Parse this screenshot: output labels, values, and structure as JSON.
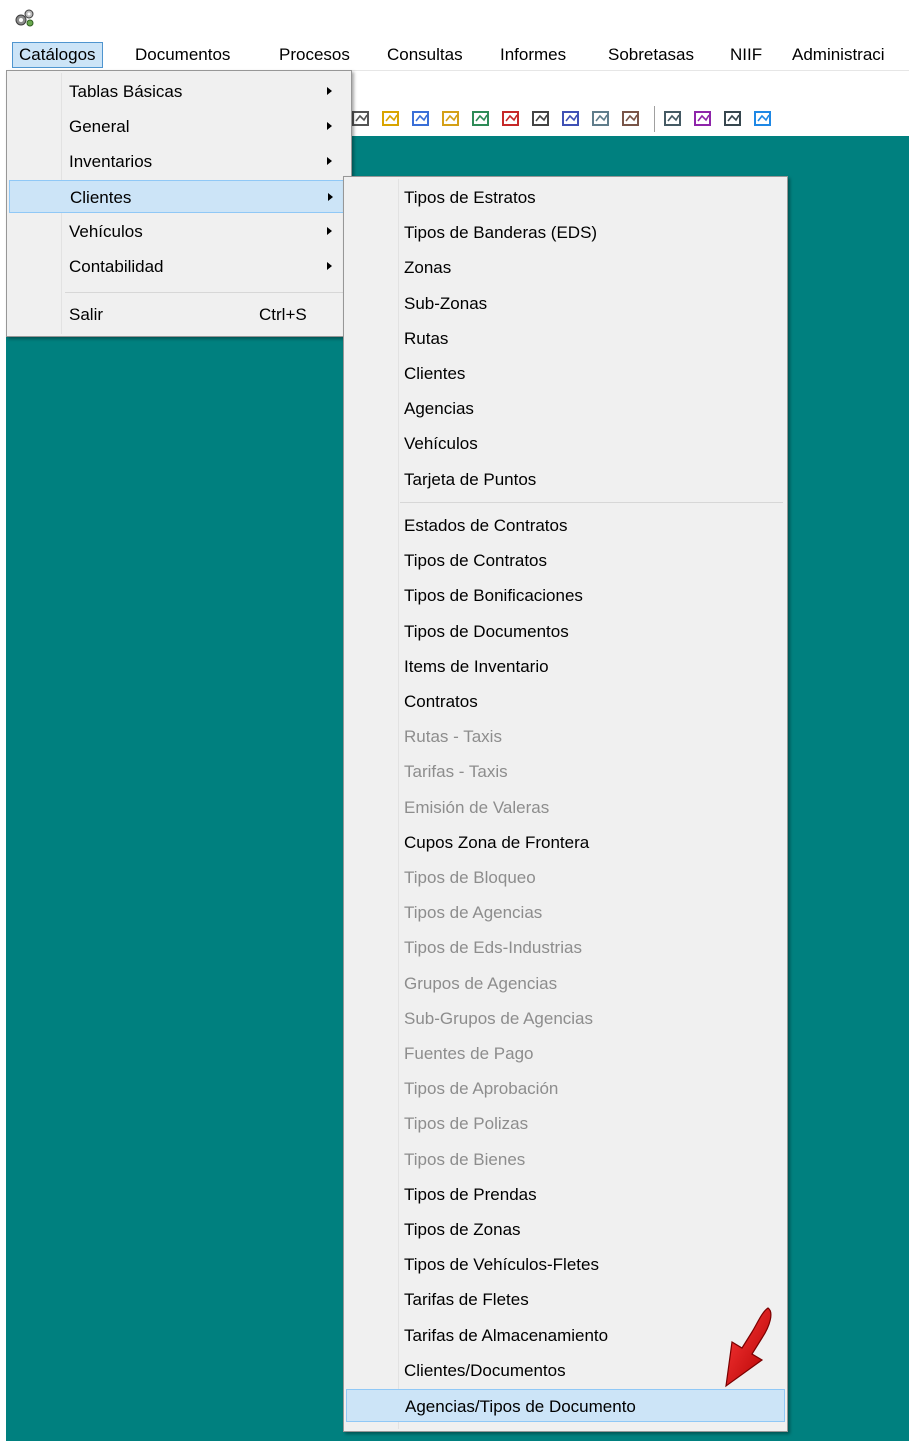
{
  "menubar": {
    "items": [
      "Catálogos",
      "Documentos",
      "Procesos",
      "Consultas",
      "Informes",
      "Sobretasas",
      "NIIF",
      "Administraci"
    ]
  },
  "catalogos_menu": {
    "items": [
      {
        "label": "Tablas Básicas",
        "submenu": true
      },
      {
        "label": "General",
        "submenu": true
      },
      {
        "label": "Inventarios",
        "submenu": true
      },
      {
        "label": "Clientes",
        "submenu": true,
        "highlighted": true
      },
      {
        "label": "Vehículos",
        "submenu": true
      },
      {
        "label": "Contabilidad",
        "submenu": true
      }
    ],
    "exit": {
      "label": "Salir",
      "shortcut": "Ctrl+S"
    }
  },
  "clientes_menu": {
    "group1": [
      {
        "label": "Tipos de Estratos",
        "enabled": true
      },
      {
        "label": "Tipos de Banderas (EDS)",
        "enabled": true
      },
      {
        "label": "Zonas",
        "enabled": true
      },
      {
        "label": "Sub-Zonas",
        "enabled": true
      },
      {
        "label": "Rutas",
        "enabled": true
      },
      {
        "label": "Clientes",
        "enabled": true
      },
      {
        "label": "Agencias",
        "enabled": true
      },
      {
        "label": "Vehículos",
        "enabled": true
      },
      {
        "label": "Tarjeta de Puntos",
        "enabled": true
      }
    ],
    "group2": [
      {
        "label": "Estados de Contratos",
        "enabled": true
      },
      {
        "label": "Tipos de Contratos",
        "enabled": true
      },
      {
        "label": "Tipos de Bonificaciones",
        "enabled": true
      },
      {
        "label": "Tipos de Documentos",
        "enabled": true
      },
      {
        "label": "Items de Inventario",
        "enabled": true
      },
      {
        "label": "Contratos",
        "enabled": true
      },
      {
        "label": "Rutas - Taxis",
        "enabled": false
      },
      {
        "label": "Tarifas - Taxis",
        "enabled": false
      },
      {
        "label": "Emisión de Valeras",
        "enabled": false
      },
      {
        "label": "Cupos Zona de Frontera",
        "enabled": true
      },
      {
        "label": "Tipos de Bloqueo",
        "enabled": false
      },
      {
        "label": "Tipos de Agencias",
        "enabled": false
      },
      {
        "label": "Tipos de Eds-Industrias",
        "enabled": false
      },
      {
        "label": "Grupos de Agencias",
        "enabled": false
      },
      {
        "label": "Sub-Grupos de Agencias",
        "enabled": false
      },
      {
        "label": "Fuentes de Pago",
        "enabled": false
      },
      {
        "label": "Tipos de Aprobación",
        "enabled": false
      },
      {
        "label": "Tipos de Polizas",
        "enabled": false
      },
      {
        "label": "Tipos de Bienes",
        "enabled": false
      },
      {
        "label": "Tipos de Prendas",
        "enabled": true
      },
      {
        "label": "Tipos de Zonas",
        "enabled": true
      },
      {
        "label": "Tipos de Vehículos-Fletes",
        "enabled": true
      },
      {
        "label": "Tarifas de Fletes",
        "enabled": true
      },
      {
        "label": "Tarifas de Almacenamiento",
        "enabled": true
      },
      {
        "label": "Clientes/Documentos",
        "enabled": true
      },
      {
        "label": "Agencias/Tipos de Documento",
        "enabled": true,
        "highlighted": true
      }
    ]
  },
  "toolbar": {
    "icons": [
      "chart-icon",
      "star-tool-icon",
      "diamond-tool-icon",
      "money-tag-icon",
      "clerk-icon",
      "truck-icon",
      "handshake-icon",
      "phone-icon",
      "report-icon",
      "book-icon",
      "forms-icon",
      "export-icon",
      "transfer-icon",
      "fc-icon"
    ]
  },
  "colors": {
    "workspace": "#00807f",
    "menu_bg": "#f0f0f0",
    "highlight": "#cce4f7",
    "disabled_text": "#8d8d8d",
    "annotation_arrow": "#e0000a"
  }
}
